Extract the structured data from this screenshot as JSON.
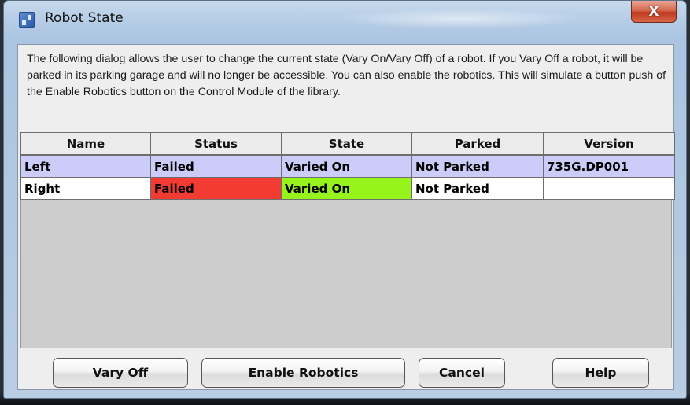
{
  "window": {
    "title": "Robot State",
    "close_label": "X"
  },
  "description": "The following dialog allows the user to change the current state (Vary On/Vary Off) of a robot. If you Vary Off a robot, it will be parked in its parking garage and will no longer be accessible. You can also enable the robotics. This will simulate a button push of the Enable Robotics button on the Control Module of the library.",
  "table": {
    "columns": [
      "Name",
      "Status",
      "State",
      "Parked",
      "Version"
    ],
    "rows": [
      {
        "name": "Left",
        "status": "Failed",
        "state": "Varied On",
        "parked": "Not Parked",
        "version": "735G.DP001",
        "selected": true
      },
      {
        "name": "Right",
        "status": "Failed",
        "state": "Varied On",
        "parked": "Not Parked",
        "version": "",
        "selected": false
      }
    ]
  },
  "buttons": {
    "vary_off": "Vary Off",
    "enable_robotics": "Enable Robotics",
    "cancel": "Cancel",
    "help": "Help"
  },
  "colors": {
    "selected_row": "#ccccf8",
    "status_failed": "#f23b32",
    "state_varied_on": "#96f31c"
  }
}
